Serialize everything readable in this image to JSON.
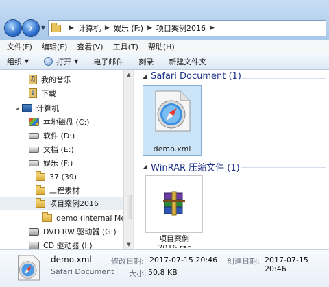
{
  "address": {
    "crumbs": [
      "计算机",
      "娱乐 (F:)",
      "项目案例2016"
    ]
  },
  "menu": [
    "文件(F)",
    "编辑(E)",
    "查看(V)",
    "工具(T)",
    "帮助(H)"
  ],
  "toolbar": {
    "organize": "组织",
    "open": "打开",
    "email": "电子邮件",
    "burn": "刻录",
    "new_folder": "新建文件夹"
  },
  "nav": {
    "music": "我的音乐",
    "downloads": "下载",
    "computer": "计算机",
    "drive_c": "本地磁盘 (C:)",
    "drive_d": "软件 (D:)",
    "drive_e": "文档 (E:)",
    "drive_f": "娱乐 (F:)",
    "folder_37": "37 (39)",
    "folder_material": "工程素材",
    "folder_project": "项目案例2016",
    "folder_demo": "demo (Internal Med",
    "drive_g": "DVD RW 驱动器 (G:)",
    "drive_i": "CD 驱动器 (I:)"
  },
  "groups": {
    "safari_header": "Safari Document (1)",
    "winrar_header": "WinRAR 压缩文件 (1)"
  },
  "files": {
    "demo_name": "demo.xml",
    "rar_name_line1": "项目案例",
    "rar_name_line2": "2016.rar"
  },
  "details": {
    "name": "demo.xml",
    "type": "Safari Document",
    "modified_label": "修改日期:",
    "modified_value": "2017-07-15 20:46",
    "created_label": "创建日期:",
    "created_value": "2017-07-15 20:46",
    "size_label": "大小:",
    "size_value": "50.8 KB"
  }
}
